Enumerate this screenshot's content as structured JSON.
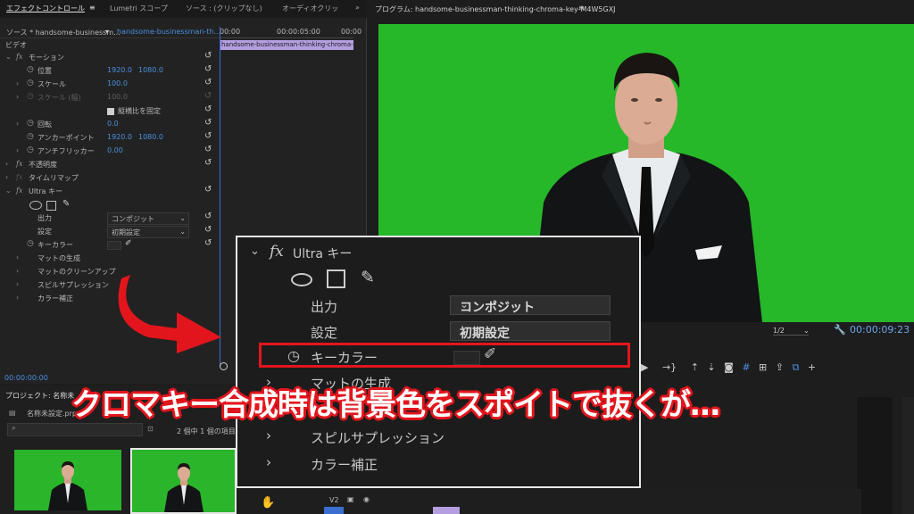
{
  "tabs": {
    "effect_controls": "エフェクトコントロール",
    "lumetri": "Lumetri スコープ",
    "source": "ソース : (クリップなし)",
    "audio": "オーディオクリッ",
    "more": "»",
    "program": "プログラム: handsome-businessman-thinking-chroma-key-M4W5GXJ"
  },
  "effect_controls": {
    "source_label": "ソース * handsome-businessm...",
    "clip_label": "handsome-businessman-th...",
    "timecodes": [
      "00:00",
      "00:00:05:00",
      "00:00"
    ],
    "timeline_clip": "handsome-businessman-thinking-chroma-key",
    "section_video": "ビデオ",
    "motion": "モーション",
    "position": "位置",
    "position_x": "1920.0",
    "position_y": "1080.0",
    "scale": "スケール",
    "scale_val": "100.0",
    "scale_w": "スケール (幅)",
    "scale_w_val": "100.0",
    "uniform": "縦横比を固定",
    "rotation": "回転",
    "rotation_val": "0.0",
    "anchor": "アンカーポイント",
    "anchor_x": "1920.0",
    "anchor_y": "1080.0",
    "antiflicker": "アンチフリッカー",
    "antiflicker_val": "0.00",
    "opacity": "不透明度",
    "time_remap": "タイムリマップ",
    "ultra_key": "Ultra キー",
    "output": "出力",
    "output_val": "コンポジット",
    "setting": "設定",
    "setting_val": "初期設定",
    "key_color": "キーカラー",
    "matte_gen": "マットの生成",
    "matte_cleanup": "マットのクリーンアップ",
    "spill": "スピルサプレッション",
    "color_correct": "カラー補正",
    "bottom_tc": "00:00:00:00"
  },
  "program": {
    "resolution": "1/2",
    "timecode": "00:00:09:23"
  },
  "project": {
    "title": "プロジェクト: 名称未",
    "name": "名称未設定.prproj",
    "count": "2 個中 1 個の項目が"
  },
  "overlay": {
    "ultra_key": "Ultra キー",
    "output": "出力",
    "output_val": "コンポジット",
    "setting": "設定",
    "setting_val": "初期設定",
    "key_color": "キーカラー",
    "matte_gen": "マットの生成",
    "spill": "スピルサプレッション",
    "color_correct": "カラー補正"
  },
  "timeline": {
    "track": "V2"
  },
  "caption": "クロマキー合成時は背景色をスポイトで抜くが…",
  "colors": {
    "accent": "#4a8fe0",
    "green_screen": "#27b829",
    "highlight": "#e3151c",
    "clip": "#b49ee0"
  }
}
